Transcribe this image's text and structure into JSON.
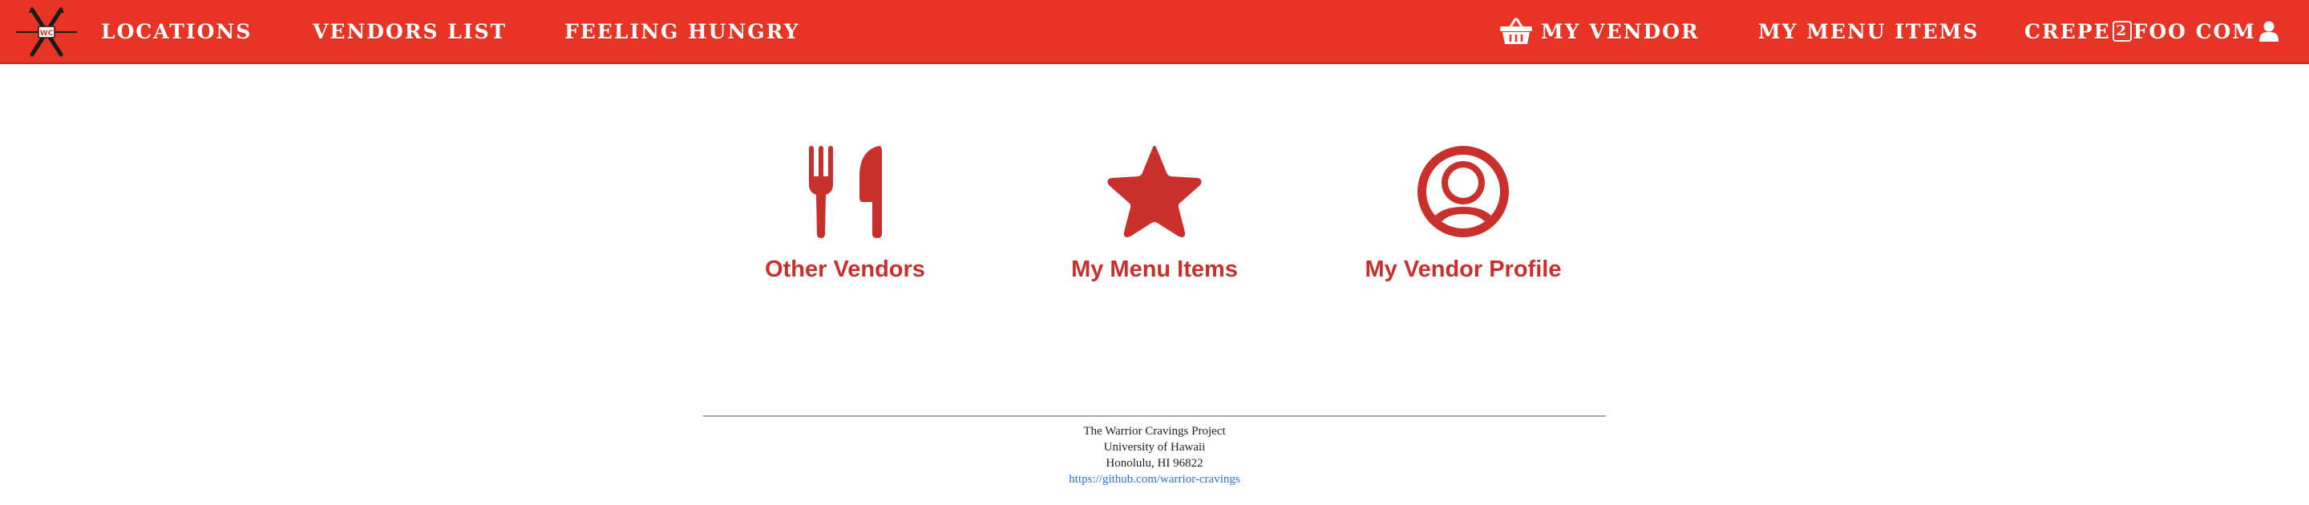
{
  "brand": {
    "logo_text": "WC",
    "accent_color": "#e83424",
    "tile_color": "#c9302c"
  },
  "navbar": {
    "left_links": [
      "Locations",
      "Vendors List",
      "Feeling Hungry"
    ],
    "right_links": {
      "my_vendor": "My Vendor",
      "my_menu_items": "My Menu Items"
    },
    "user": {
      "name_part1": "crepe",
      "at_glyph": "2",
      "name_part2": "foo com",
      "icon": "user-icon"
    },
    "cart_icon": "basket-icon"
  },
  "tiles": [
    {
      "label": "Other Vendors",
      "icon": "utensils-icon"
    },
    {
      "label": "My Menu Items",
      "icon": "star-icon"
    },
    {
      "label": "My Vendor Profile",
      "icon": "user-circle-icon"
    }
  ],
  "footer": {
    "line1": "The Warrior Cravings Project",
    "line2": "University of Hawaii",
    "line3": "Honolulu, HI 96822",
    "link": "https://github.com/warrior-cravings"
  }
}
